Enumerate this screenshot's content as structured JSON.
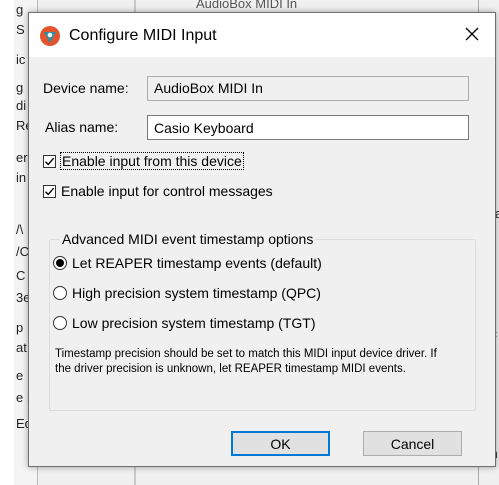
{
  "background_window": {
    "title_fragment": "AudioBox MIDI In",
    "left_fragments": [
      "g",
      "S",
      "ic",
      "g",
      "di",
      "Re",
      "er",
      "in",
      "/\\",
      "/C",
      "C",
      "3e",
      "p",
      "at",
      "e",
      "e N",
      "Ed"
    ],
    "right_fragments": [
      "e a",
      "tic",
      "ch"
    ]
  },
  "dialog": {
    "title": "Configure MIDI Input",
    "icons": {
      "app": "reaper-app-icon",
      "close": "close-icon"
    },
    "device_name": {
      "label": "Device name:",
      "value": "AudioBox MIDI In"
    },
    "alias_name": {
      "label": "Alias name:",
      "value": "Casio Keyboard"
    },
    "checkboxes": [
      {
        "label": "Enable input from this device",
        "checked": true
      },
      {
        "label": "Enable input for control messages",
        "checked": true
      }
    ],
    "timestamp_group": {
      "legend": "Advanced MIDI event timestamp options",
      "options": [
        {
          "label": "Let REAPER timestamp events (default)",
          "selected": true
        },
        {
          "label": "High precision system timestamp (QPC)",
          "selected": false
        },
        {
          "label": "Low precision system timestamp (TGT)",
          "selected": false
        }
      ],
      "note": "Timestamp precision should be set to match this MIDI input device driver. If the driver precision is unknown, let REAPER timestamp MIDI events."
    },
    "buttons": {
      "ok": "OK",
      "cancel": "Cancel"
    }
  },
  "colors": {
    "accent": "#0078d7",
    "dialog_bg": "#f0f0f0",
    "titlebar_bg": "#ffffff",
    "icon_red": "#e2552f",
    "icon_teal": "#2f8fa0"
  }
}
